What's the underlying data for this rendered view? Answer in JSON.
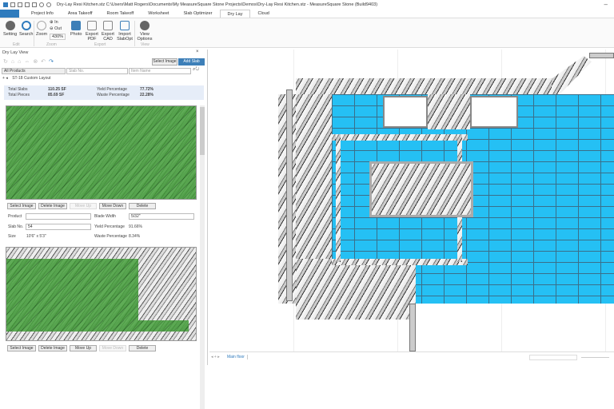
{
  "window": {
    "title": "Dry-Lay Resi Kitchen.stz C:\\Users\\Matt Rogers\\Documents\\My MeasureSquare Stone Projects\\Demos\\Dry-Lay Resi Kitchen.stz - MeasureSquare Stone (Build9403)"
  },
  "tabs": [
    "Project Info",
    "Area Takeoff",
    "Room Takeoff",
    "Worksheet",
    "Slab Optimizer",
    "Dry Lay",
    "Cloud"
  ],
  "active_tab": "Dry Lay",
  "ribbon": {
    "setting": "Setting",
    "search": "Search",
    "zoom": "Zoom",
    "zoom_in": "In",
    "zoom_out": "Out",
    "zoom_level": "430%",
    "photo": "Photo",
    "export_pdf": "Export PDF",
    "export_cad": "Export CAD",
    "import_slabopt": "Import SlabOpt",
    "view_options": "View Options",
    "groups": [
      "Edit",
      "Zoom",
      "Export",
      "View"
    ]
  },
  "panel": {
    "title": "Dry Lay View",
    "select_image": "Select Image",
    "add_slab": "Add Slab",
    "product_filter": "All Products",
    "slab_no_placeholder": "Slab No.",
    "item_name_placeholder": "Item Name",
    "layout_tab": "ST-18 Custom Layout",
    "summary": {
      "total_slabs_label": "Total Slabs",
      "total_slabs": "110.25 SF",
      "total_pieces_label": "Total Pieces",
      "total_pieces": "85.69 SF",
      "yield_label": "Yield Percentage",
      "yield": "77.72%",
      "waste_label": "Waste Percentage",
      "waste": "22.28%"
    },
    "buttons": {
      "select_image": "Select Image",
      "delete_image": "Delete Image",
      "move_up": "Move Up",
      "move_down": "Move Down",
      "delete": "Delete"
    },
    "slab": {
      "product_label": "Product",
      "product": "",
      "blade_label": "Blade Width",
      "blade": "5/32\"",
      "slab_no_label": "Slab No.",
      "slab_no": "54",
      "yield_label": "Yield Percentage",
      "yield": "91.66%",
      "size_label": "Size",
      "size": "10'6\" x 5'3\"",
      "waste_label": "Waste Percentage",
      "waste": "8.34%"
    }
  },
  "status": {
    "floor_tab": "Main floor"
  },
  "colors": {
    "accent": "#3d7fb8",
    "tile": "#25c0f4",
    "fit_green": "#4a9e3f"
  }
}
